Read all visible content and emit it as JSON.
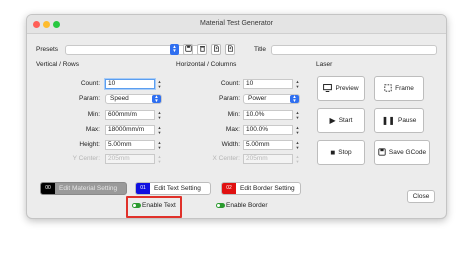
{
  "window": {
    "title": "Material Test Generator"
  },
  "presets": {
    "label": "Presets",
    "title_label": "Title",
    "value": "",
    "title_value": ""
  },
  "toolbar": {
    "save_icon": "floppy-disk-icon",
    "delete_icon": "trash-icon",
    "export_icon": "file-export-icon",
    "import_icon": "file-import-icon",
    "preset_stepper_icon": "stepper-icon"
  },
  "vertical": {
    "heading": "Vertical / Rows",
    "count_label": "Count:",
    "count_value": "10",
    "param_label": "Param:",
    "param_value": "Speed",
    "min_label": "Min:",
    "min_value": "600mm/m",
    "max_label": "Max:",
    "max_value": "18000mm/m",
    "height_label": "Height:",
    "height_value": "5.00mm",
    "ycenter_label": "Y Center:",
    "ycenter_value": "205mm"
  },
  "horizontal": {
    "heading": "Horizontal / Columns",
    "count_label": "Count:",
    "count_value": "10",
    "param_label": "Param:",
    "param_value": "Power",
    "min_label": "Min:",
    "min_value": "10.0%",
    "max_label": "Max:",
    "max_value": "100.0%",
    "width_label": "Width:",
    "width_value": "5.00mm",
    "xcenter_label": "X Center:",
    "xcenter_value": "205mm"
  },
  "laser": {
    "heading": "Laser",
    "preview": "Preview",
    "frame": "Frame",
    "start": "Start",
    "pause": "Pause",
    "stop": "Stop",
    "save_gcode": "Save GCode"
  },
  "settings": {
    "material_swatch": "00",
    "material_label": "Edit Material Setting",
    "text_swatch": "01",
    "text_label": "Edit Text Setting",
    "border_swatch": "02",
    "border_label": "Edit Border Setting",
    "colors": {
      "material": "#000000",
      "text": "#1010e0",
      "border": "#e01010"
    }
  },
  "toggles": {
    "enable_text": "Enable Text",
    "enable_border": "Enable Border"
  },
  "close_label": "Close"
}
